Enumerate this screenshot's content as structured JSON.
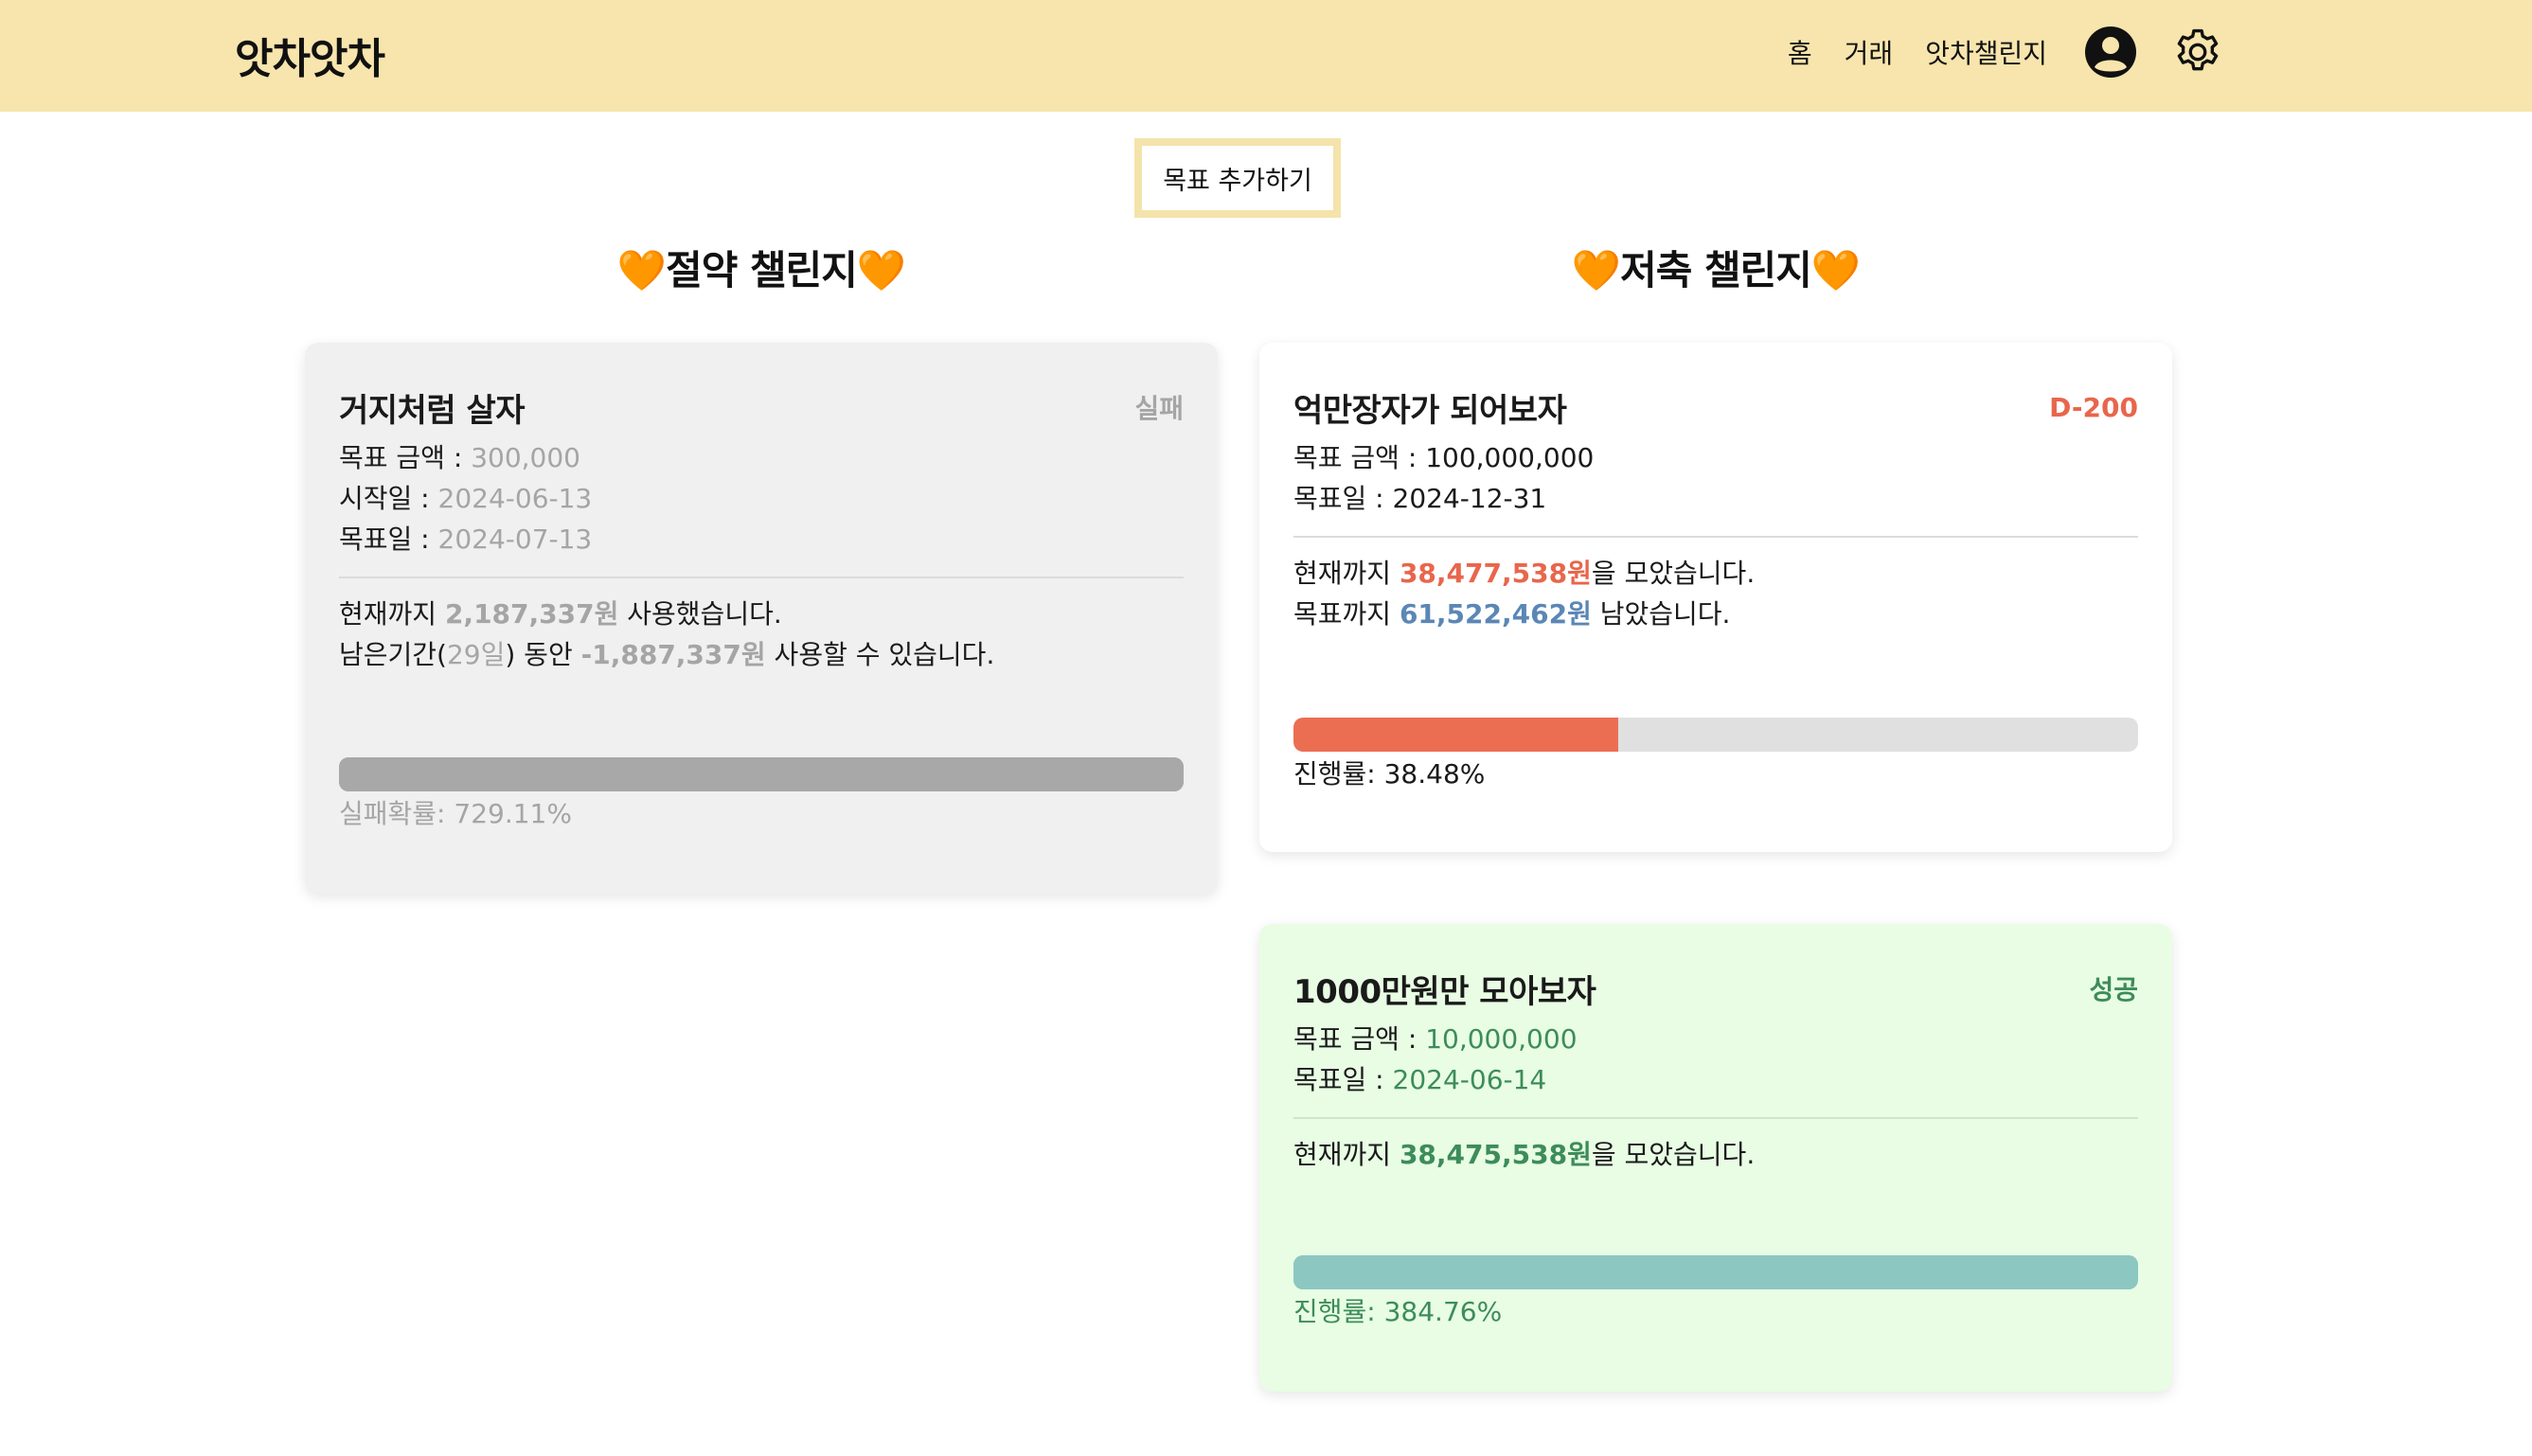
{
  "header": {
    "brand": "앗차앗차",
    "nav": [
      "홈",
      "거래",
      "앗차챌린지"
    ],
    "icons": [
      "user-circle-icon",
      "gear-icon"
    ]
  },
  "add_goal_label": "목표 추가하기",
  "sections": {
    "left_title": "🧡절약 챌린지🧡",
    "right_title": "🧡저축 챌린지🧡"
  },
  "cards": {
    "fail": {
      "title": "거지처럼 살자",
      "badge": "실패",
      "amount_label": "목표 금액 : ",
      "amount": "300,000",
      "start_label": "시작일 : ",
      "start": "2024-06-13",
      "goal_label": "목표일 : ",
      "goal": "2024-07-13",
      "used_prefix": "현재까지 ",
      "used": "2,187,337원",
      "used_suffix": " 사용했습니다.",
      "remain_prefix": "남은기간(",
      "remain_days": "29일",
      "remain_mid": ") 동안 ",
      "remain_amount": "-1,887,337원",
      "remain_suffix": " 사용할 수 있습니다.",
      "progress_label": "실패확률: 729.11%",
      "progress_percent": 100
    },
    "active": {
      "title": "억만장자가 되어보자",
      "badge": "D-200",
      "amount_label": "목표 금액 : ",
      "amount": "100,000,000",
      "goal_label": "목표일 : ",
      "goal": "2024-12-31",
      "saved_prefix": "현재까지 ",
      "saved": "38,477,538원",
      "saved_suffix": "을 모았습니다.",
      "left_prefix": "목표까지 ",
      "left": "61,522,462원",
      "left_suffix": " 남았습니다.",
      "progress_label": "진행률: 38.48%",
      "progress_percent": 38.48
    },
    "success": {
      "title": "1000만원만 모아보자",
      "badge": "성공",
      "amount_label": "목표 금액 : ",
      "amount": "10,000,000",
      "goal_label": "목표일 : ",
      "goal": "2024-06-14",
      "saved_prefix": "현재까지 ",
      "saved": "38,475,538원",
      "saved_suffix": "을 모았습니다.",
      "progress_label": "진행률: 384.76%",
      "progress_percent": 100
    }
  },
  "colors": {
    "header_bg": "#f7e5ad",
    "accent_orange": "#e8664c",
    "accent_blue": "#5b87b5",
    "success_green": "#3d8c5a",
    "success_bg": "#e8fde4",
    "fail_bg": "#f0f0f0"
  }
}
